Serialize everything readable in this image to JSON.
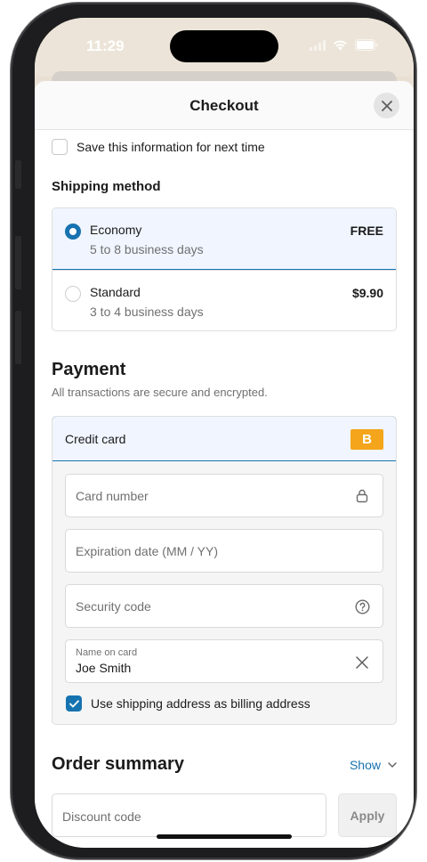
{
  "status_bar": {
    "time": "11:29"
  },
  "sheet": {
    "title": "Checkout"
  },
  "save_info": {
    "label": "Save this information for next time",
    "checked": false
  },
  "shipping": {
    "title": "Shipping method",
    "options": [
      {
        "name": "Economy",
        "subtitle": "5 to 8 business days",
        "price": "FREE",
        "selected": true
      },
      {
        "name": "Standard",
        "subtitle": "3 to 4 business days",
        "price": "$9.90",
        "selected": false
      }
    ]
  },
  "payment": {
    "title": "Payment",
    "subtitle": "All transactions are secure and encrypted.",
    "method_label": "Credit card",
    "badge": "B",
    "fields": {
      "card_number": {
        "placeholder": "Card number",
        "icon": "lock-icon"
      },
      "expiration": {
        "placeholder": "Expiration date (MM / YY)"
      },
      "security_code": {
        "placeholder": "Security code",
        "icon": "help-circle-icon"
      },
      "name_on_card": {
        "label": "Name on card",
        "value": "Joe Smith",
        "icon": "clear-icon"
      }
    },
    "billing": {
      "label": "Use shipping address as billing address",
      "checked": true
    }
  },
  "order_summary": {
    "title": "Order summary",
    "toggle_label": "Show"
  },
  "discount": {
    "placeholder": "Discount code",
    "apply_label": "Apply"
  },
  "colors": {
    "accent": "#1773b0",
    "badge": "#f4a51c",
    "selected_bg": "#f0f5ff"
  }
}
